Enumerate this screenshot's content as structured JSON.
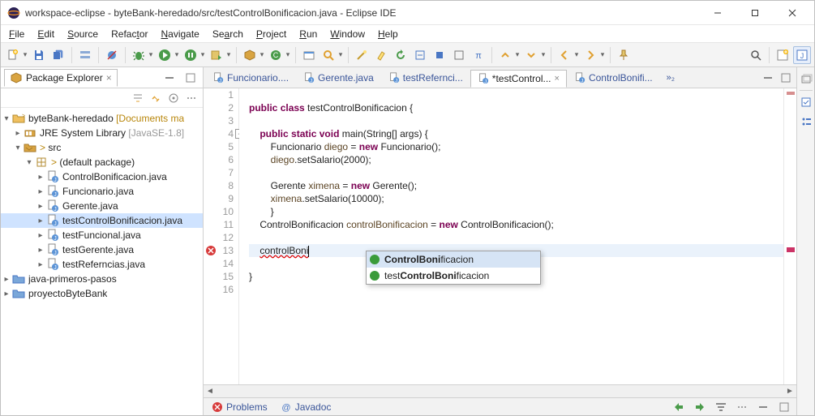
{
  "window": {
    "title": "workspace-eclipse - byteBank-heredado/src/testControlBonificacion.java - Eclipse IDE"
  },
  "menu": [
    "File",
    "Edit",
    "Source",
    "Refactor",
    "Navigate",
    "Search",
    "Project",
    "Run",
    "Window",
    "Help"
  ],
  "sidebar": {
    "title": "Package Explorer",
    "project": {
      "name": "byteBank-heredado",
      "decorator": "[Documents ma"
    },
    "jre": {
      "name": "JRE System Library",
      "decorator": "[JavaSE-1.8]"
    },
    "src": "src",
    "pkg": "(default package)",
    "files": [
      "ControlBonificacion.java",
      "Funcionario.java",
      "Gerente.java",
      "testControlBonificacion.java",
      "testFuncional.java",
      "testGerente.java",
      "testReferncias.java"
    ],
    "closed": [
      "java-primeros-pasos",
      "proyectoByteBank"
    ]
  },
  "editor": {
    "tabs": [
      {
        "label": "Funcionario...."
      },
      {
        "label": "Gerente.java"
      },
      {
        "label": "testRefernci..."
      },
      {
        "label": "*testControl...",
        "active": true
      },
      {
        "label": "ControlBonifi..."
      }
    ],
    "overflow": "»₂",
    "autocomplete": [
      {
        "pre": "",
        "bold": "ControlBoni",
        "post": "ficacion"
      },
      {
        "pre": "test",
        "bold": "ControlBoni",
        "post": "ficacion"
      }
    ]
  },
  "bottom": {
    "tabs": [
      "Problems",
      "Javadoc"
    ]
  }
}
